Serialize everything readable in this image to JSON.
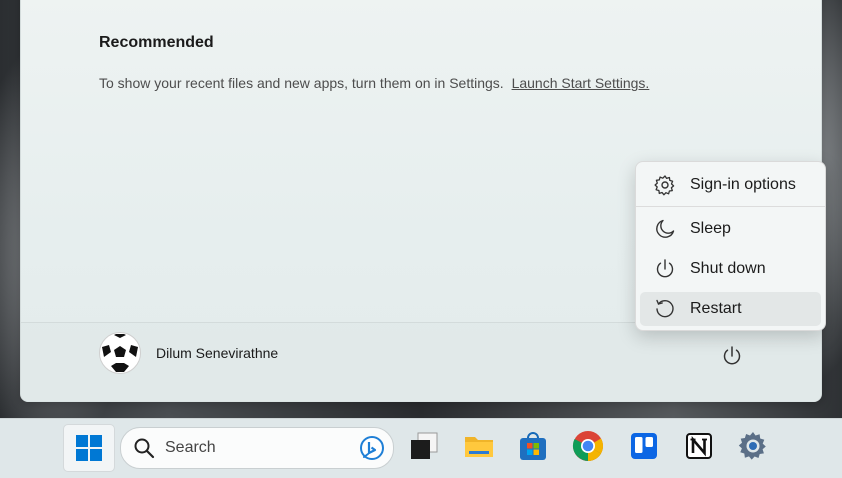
{
  "start_menu": {
    "recommended_title": "Recommended",
    "recommended_text": "To show your recent files and new apps, turn them on in Settings.",
    "recommended_link": "Launch Start Settings.",
    "user_name": "Dilum Senevirathne"
  },
  "power_menu": {
    "items": [
      {
        "label": "Sign-in options",
        "icon": "gear-icon"
      },
      {
        "label": "Sleep",
        "icon": "moon-icon"
      },
      {
        "label": "Shut down",
        "icon": "power-icon"
      },
      {
        "label": "Restart",
        "icon": "restart-icon",
        "hovered": true
      }
    ]
  },
  "taskbar": {
    "search_placeholder": "Search",
    "apps": [
      "task-view",
      "file-explorer",
      "microsoft-store",
      "chrome",
      "trello",
      "notion",
      "settings"
    ]
  },
  "colors": {
    "windows_blue": "#0078d4",
    "highlight": "#e3e7e7"
  }
}
